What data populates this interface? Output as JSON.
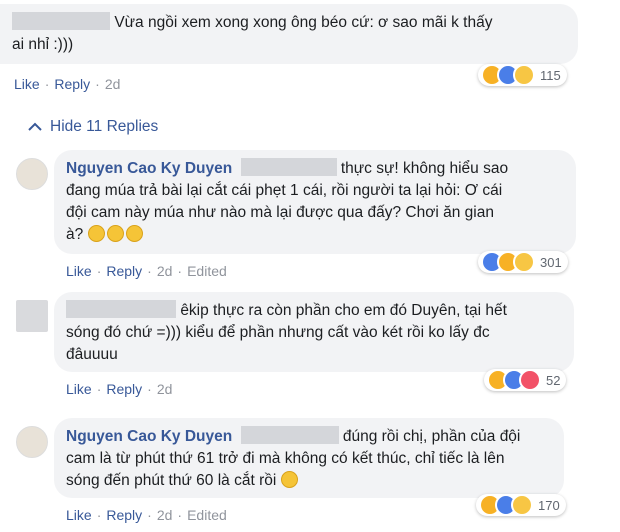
{
  "comments": [
    {
      "author": "",
      "text_line1": "Vừa ngồi xem xong xong ông béo cứ: ơ sao mãi k thấy",
      "text_line2": "ai nhỉ :)))",
      "like": "Like",
      "reply": "Reply",
      "time": "2d",
      "reaction_count": "115"
    },
    {
      "author": "Nguyen Cao Ky Duyen",
      "text_line1": "thực sự! không hiểu sao",
      "text_line2": "đang múa trả bài lại cắt cái phẹt 1 cái, rồi người ta lại hỏi: Ơ cái",
      "text_line3": "đội cam này múa như nào mà lại được qua đấy? Chơi ăn gian",
      "text_line4": "à?",
      "like": "Like",
      "reply": "Reply",
      "time": "2d",
      "edited": "Edited",
      "reaction_count": "301"
    },
    {
      "author": "",
      "text_line1": "êkip thực ra còn phần cho em đó Duyên, tại hết",
      "text_line2": "sóng đó chứ =))) kiểu để phần nhưng cất vào két rồi ko lấy đc",
      "text_line3": "đâuuuu",
      "like": "Like",
      "reply": "Reply",
      "time": "2d",
      "reaction_count": "52"
    },
    {
      "author": "Nguyen Cao Ky Duyen",
      "text_line1": "đúng rồi chị, phần của đội",
      "text_line2": "cam là từ phút thứ 61 trở đi mà không có kết thúc, chỉ tiếc là lên",
      "text_line3": "sóng đến phút thứ 60 là cắt rồi",
      "like": "Like",
      "reply": "Reply",
      "time": "2d",
      "edited": "Edited",
      "reaction_count": "170"
    }
  ],
  "hide_replies_label": "Hide 11 Replies",
  "icons": [
    "haha-icon",
    "like-icon",
    "sad-icon",
    "love-icon",
    "smile-emoji",
    "sad-emoji",
    "chevron-up-icon"
  ],
  "colors": {
    "link": "#385898",
    "bubble": "#f2f3f5",
    "meta": "#90949c"
  }
}
